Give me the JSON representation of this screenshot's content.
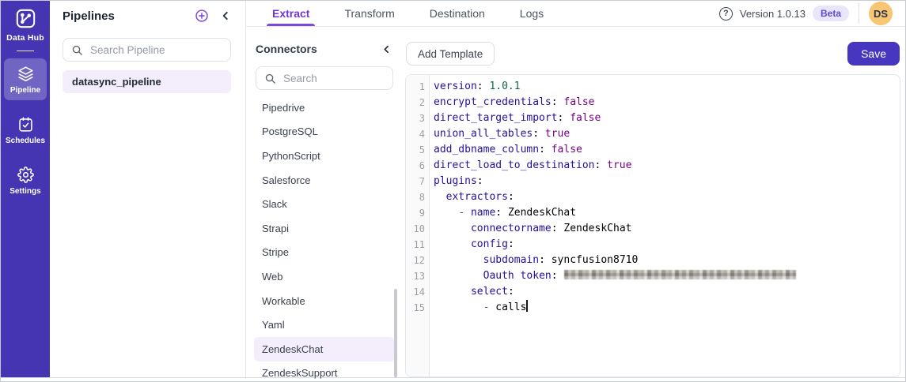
{
  "sidebar": {
    "brand": "Data Hub",
    "items": [
      {
        "label": "Pipeline",
        "icon": "layers-icon",
        "active": true
      },
      {
        "label": "Schedules",
        "icon": "calendar-icon",
        "active": false
      },
      {
        "label": "Settings",
        "icon": "gear-icon",
        "active": false
      }
    ]
  },
  "pipelines_panel": {
    "title": "Pipelines",
    "search_placeholder": "Search Pipeline",
    "items": [
      "datasync_pipeline"
    ]
  },
  "tabs": [
    {
      "label": "Extract",
      "active": true
    },
    {
      "label": "Transform",
      "active": false
    },
    {
      "label": "Destination",
      "active": false
    },
    {
      "label": "Logs",
      "active": false
    }
  ],
  "header": {
    "version": "Version 1.0.13",
    "badge": "Beta",
    "avatar_initials": "DS",
    "help_glyph": "?"
  },
  "connectors_panel": {
    "title": "Connectors",
    "search_placeholder": "Search",
    "items": [
      "Pipedrive",
      "PostgreSQL",
      "PythonScript",
      "Salesforce",
      "Slack",
      "Strapi",
      "Stripe",
      "Web",
      "Workable",
      "Yaml",
      "ZendeskChat",
      "ZendeskSupport"
    ],
    "selected": "ZendeskChat"
  },
  "toolbar": {
    "add_template_label": "Add Template",
    "save_label": "Save"
  },
  "editor": {
    "language": "yaml",
    "lines": [
      {
        "tokens": [
          {
            "t": "version",
            "c": "key"
          },
          {
            "t": ": ",
            "c": "plain"
          },
          {
            "t": "1.0.1",
            "c": "num"
          }
        ]
      },
      {
        "tokens": [
          {
            "t": "encrypt_credentials",
            "c": "key"
          },
          {
            "t": ": ",
            "c": "plain"
          },
          {
            "t": "false",
            "c": "bool"
          }
        ]
      },
      {
        "tokens": [
          {
            "t": "direct_target_import",
            "c": "key"
          },
          {
            "t": ": ",
            "c": "plain"
          },
          {
            "t": "false",
            "c": "bool"
          }
        ]
      },
      {
        "tokens": [
          {
            "t": "union_all_tables",
            "c": "key"
          },
          {
            "t": ": ",
            "c": "plain"
          },
          {
            "t": "true",
            "c": "bool"
          }
        ]
      },
      {
        "tokens": [
          {
            "t": "add_dbname_column",
            "c": "key"
          },
          {
            "t": ": ",
            "c": "plain"
          },
          {
            "t": "false",
            "c": "bool"
          }
        ]
      },
      {
        "tokens": [
          {
            "t": "direct_load_to_destination",
            "c": "key"
          },
          {
            "t": ": ",
            "c": "plain"
          },
          {
            "t": "true",
            "c": "bool"
          }
        ]
      },
      {
        "tokens": [
          {
            "t": "plugins",
            "c": "key"
          },
          {
            "t": ":",
            "c": "plain"
          }
        ]
      },
      {
        "tokens": [
          {
            "t": "  ",
            "c": "plain"
          },
          {
            "t": "extractors",
            "c": "key"
          },
          {
            "t": ":",
            "c": "plain"
          }
        ]
      },
      {
        "tokens": [
          {
            "t": "    ",
            "c": "plain"
          },
          {
            "t": "- ",
            "c": "meta"
          },
          {
            "t": "name",
            "c": "key"
          },
          {
            "t": ": ",
            "c": "plain"
          },
          {
            "t": "ZendeskChat",
            "c": "plain"
          }
        ]
      },
      {
        "tokens": [
          {
            "t": "      ",
            "c": "plain"
          },
          {
            "t": "connectorname",
            "c": "key"
          },
          {
            "t": ": ",
            "c": "plain"
          },
          {
            "t": "ZendeskChat",
            "c": "plain"
          }
        ]
      },
      {
        "tokens": [
          {
            "t": "      ",
            "c": "plain"
          },
          {
            "t": "config",
            "c": "key"
          },
          {
            "t": ":",
            "c": "plain"
          }
        ]
      },
      {
        "tokens": [
          {
            "t": "        ",
            "c": "plain"
          },
          {
            "t": "subdomain",
            "c": "key"
          },
          {
            "t": ": ",
            "c": "plain"
          },
          {
            "t": "syncfusion8710",
            "c": "plain"
          }
        ]
      },
      {
        "tokens": [
          {
            "t": "        ",
            "c": "plain"
          },
          {
            "t": "Oauth token",
            "c": "key"
          },
          {
            "t": ": ",
            "c": "plain"
          },
          {
            "t": "",
            "c": "redacted"
          }
        ]
      },
      {
        "tokens": [
          {
            "t": "      ",
            "c": "plain"
          },
          {
            "t": "select",
            "c": "key"
          },
          {
            "t": ":",
            "c": "plain"
          }
        ]
      },
      {
        "tokens": [
          {
            "t": "        ",
            "c": "plain"
          },
          {
            "t": "- ",
            "c": "meta"
          },
          {
            "t": "calls",
            "c": "plain"
          },
          {
            "t": "",
            "c": "caret"
          }
        ]
      }
    ]
  },
  "colors": {
    "sidebar_bg": "#4535b2",
    "accent_purple": "#7136d4",
    "save_button_bg": "#4736c0",
    "selected_item_bg": "#f4edfc",
    "beta_badge_bg": "#e9e5fb",
    "beta_badge_text": "#5e4ad6",
    "avatar_bg": "#f6c672",
    "token_key": "#221199",
    "token_number": "#116644",
    "token_boolean": "#770088",
    "token_meta": "#555555"
  }
}
